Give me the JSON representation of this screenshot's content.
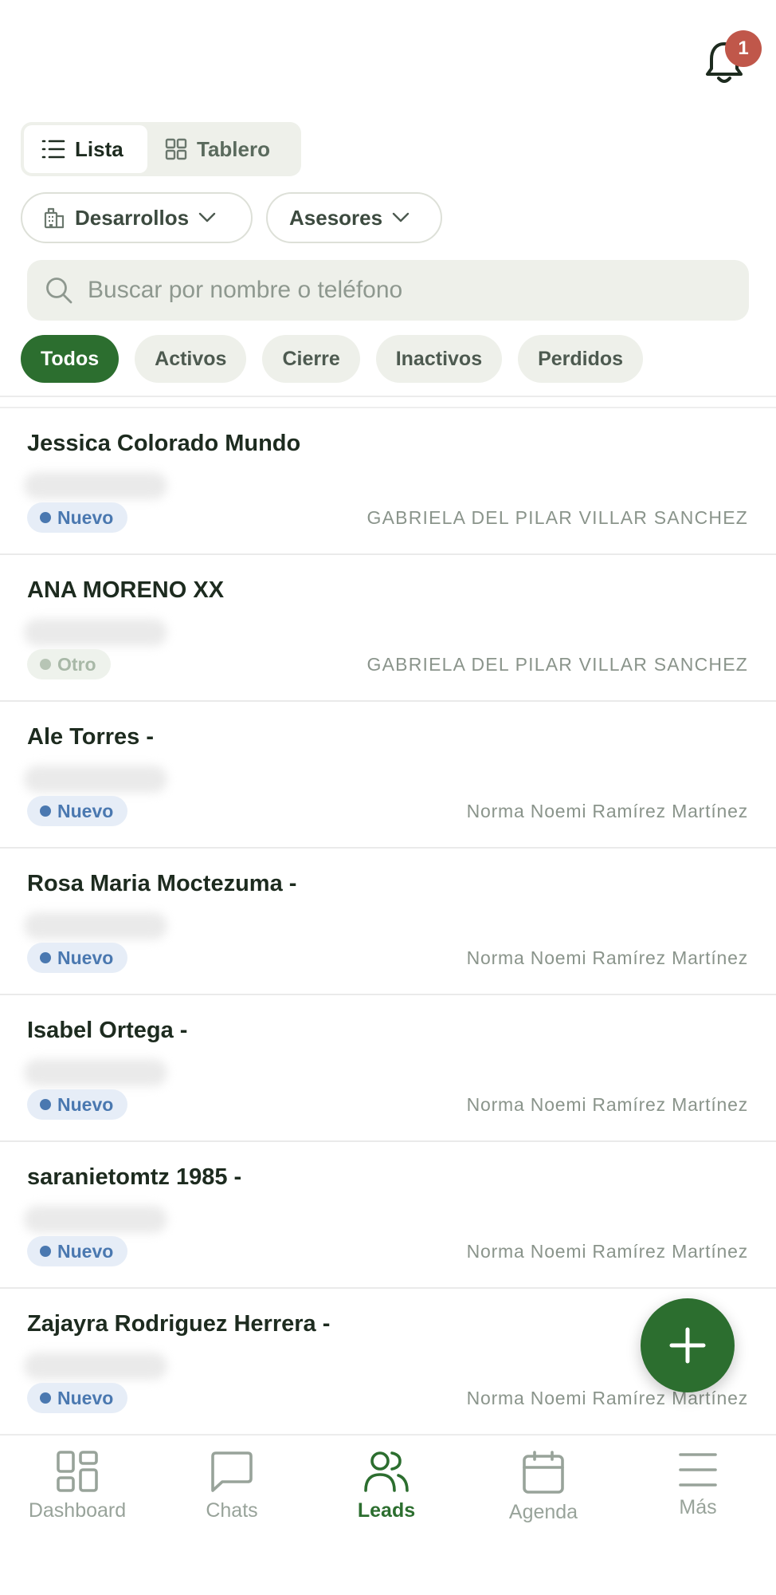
{
  "header": {
    "notification_count": "1"
  },
  "view_toggle": {
    "list_label": "Lista",
    "board_label": "Tablero"
  },
  "filters": {
    "developments_label": "Desarrollos",
    "advisors_label": "Asesores"
  },
  "search": {
    "placeholder": "Buscar por nombre o teléfono"
  },
  "status_chips": [
    "Todos",
    "Activos",
    "Cierre",
    "Inactivos",
    "Perdidos"
  ],
  "leads": [
    {
      "name": "Jessica Colorado Mundo",
      "status": "Nuevo",
      "agent": "GABRIELA DEL PILAR VILLAR SANCHEZ"
    },
    {
      "name": "ANA MORENO XX",
      "status": "Otro",
      "agent": "GABRIELA DEL PILAR VILLAR SANCHEZ"
    },
    {
      "name": "Ale Torres -",
      "status": "Nuevo",
      "agent": "Norma Noemi Ramírez Martínez"
    },
    {
      "name": "Rosa Maria Moctezuma -",
      "status": "Nuevo",
      "agent": "Norma Noemi Ramírez Martínez"
    },
    {
      "name": "Isabel Ortega -",
      "status": "Nuevo",
      "agent": "Norma Noemi Ramírez Martínez"
    },
    {
      "name": "saranietomtz 1985 -",
      "status": "Nuevo",
      "agent": "Norma Noemi Ramírez Martínez"
    },
    {
      "name": "Zajayra Rodriguez Herrera -",
      "status": "Nuevo",
      "agent": "Norma Noemi Ramírez Martínez"
    }
  ],
  "bottom_nav": {
    "dashboard": "Dashboard",
    "chats": "Chats",
    "leads": "Leads",
    "agenda": "Agenda",
    "more": "Más"
  },
  "colors": {
    "accent": "#2c6e2f",
    "badge_red": "#c0574a",
    "status_new": "#4a78b0"
  }
}
